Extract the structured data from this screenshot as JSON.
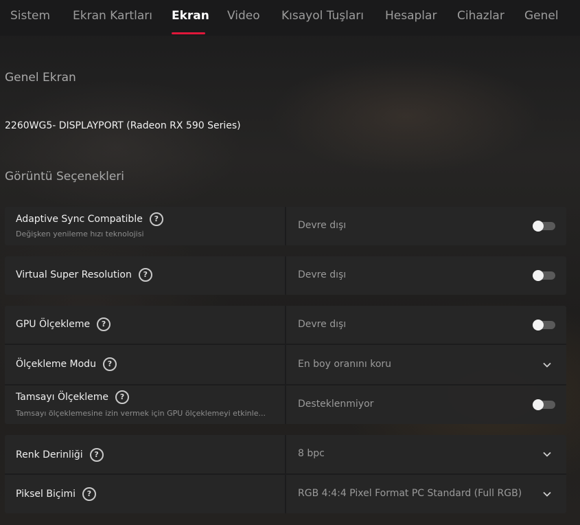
{
  "tabs": [
    {
      "label": "Sistem",
      "active": false
    },
    {
      "label": "Ekran Kartları",
      "active": false
    },
    {
      "label": "Ekran",
      "active": true
    },
    {
      "label": "Video",
      "active": false
    },
    {
      "label": "Kısayol Tuşları",
      "active": false
    },
    {
      "label": "Hesaplar",
      "active": false
    },
    {
      "label": "Cihazlar",
      "active": false
    },
    {
      "label": "Genel",
      "active": false
    }
  ],
  "accent_color": "#e0173a",
  "general_display": {
    "heading": "Genel Ekran",
    "display_name": "2260WG5- DISPLAYPORT (Radeon RX 590 Series)"
  },
  "display_options": {
    "heading": "Görüntü Seçenekleri",
    "adaptive_sync": {
      "label": "Adaptive Sync Compatible",
      "sublabel": "Değişken yenileme hızı teknolojisi",
      "value": "Devre dışı",
      "control": "toggle",
      "enabled": false
    },
    "vsr": {
      "label": "Virtual Super Resolution",
      "value": "Devre dışı",
      "control": "toggle",
      "enabled": false
    },
    "gpu_scaling": {
      "label": "GPU Ölçekleme",
      "value": "Devre dışı",
      "control": "toggle",
      "enabled": false
    },
    "scaling_mode": {
      "label": "Ölçekleme Modu",
      "value": "En boy oranını koru",
      "control": "dropdown"
    },
    "integer_scaling": {
      "label": "Tamsayı Ölçekleme",
      "sublabel": "Tamsayı ölçeklemesine izin vermek için GPU ölçeklemeyi etkinle...",
      "value": "Desteklenmiyor",
      "control": "toggle",
      "enabled": false
    },
    "color_depth": {
      "label": "Renk Derinliği",
      "value": "8 bpc",
      "control": "dropdown"
    },
    "pixel_format": {
      "label": "Piksel Biçimi",
      "value": "RGB 4:4:4 Pixel Format PC Standard (Full RGB)",
      "control": "dropdown"
    }
  },
  "icons": {
    "help": "question-circle-icon",
    "dropdown": "chevron-down-icon",
    "help_glyph": "?"
  }
}
